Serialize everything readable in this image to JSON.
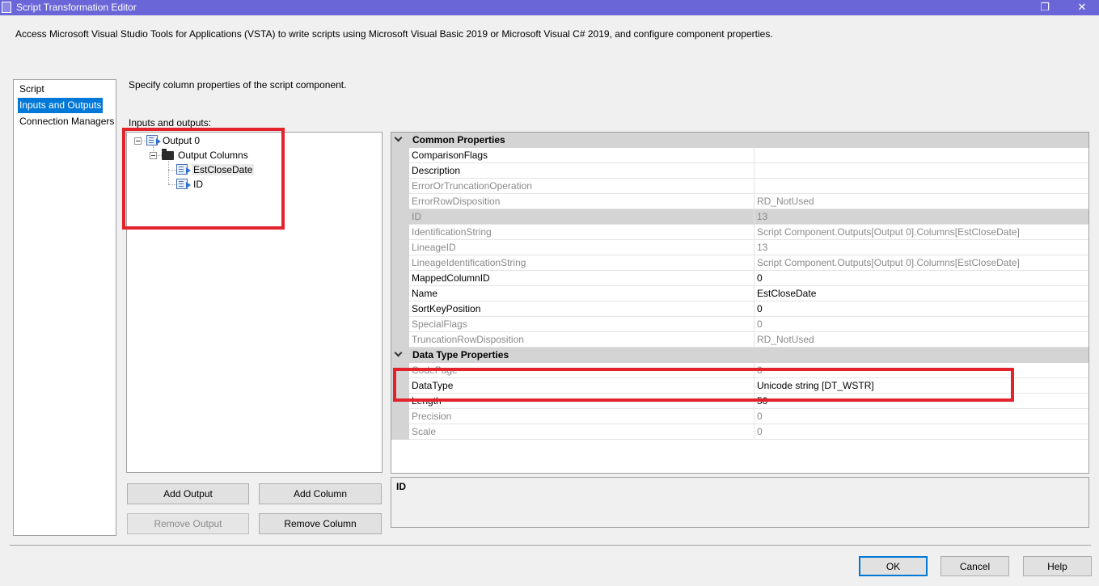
{
  "window": {
    "title": "Script Transformation Editor",
    "restore_glyph": "❐",
    "close_glyph": "✕"
  },
  "header": {
    "description": "Access Microsoft Visual Studio Tools for Applications (VSTA) to write scripts using Microsoft Visual Basic 2019 or Microsoft Visual C# 2019, and configure component properties."
  },
  "sidebar": {
    "items": [
      {
        "label": "Script",
        "selected": false
      },
      {
        "label": "Inputs and Outputs",
        "selected": true
      },
      {
        "label": "Connection Managers",
        "selected": false
      }
    ]
  },
  "main": {
    "description": "Specify column properties of the script component.",
    "tree_label": "Inputs and outputs:",
    "tree": {
      "output": "Output 0",
      "columns_folder": "Output Columns",
      "columns": [
        "EstCloseDate",
        "ID"
      ],
      "selected_column": "EstCloseDate"
    }
  },
  "buttons": {
    "add_output": "Add Output",
    "add_column": "Add Column",
    "remove_output": "Remove Output",
    "remove_column": "Remove Column",
    "ok": "OK",
    "cancel": "Cancel",
    "help": "Help"
  },
  "properties": {
    "categories": [
      {
        "label": "Common Properties",
        "rows": [
          {
            "name": "ComparisonFlags",
            "value": "",
            "readonly": false
          },
          {
            "name": "Description",
            "value": "",
            "readonly": false
          },
          {
            "name": "ErrorOrTruncationOperation",
            "value": "",
            "readonly": true
          },
          {
            "name": "ErrorRowDisposition",
            "value": "RD_NotUsed",
            "readonly": true
          },
          {
            "name": "ID",
            "value": "13",
            "readonly": true,
            "selected": true
          },
          {
            "name": "IdentificationString",
            "value": "Script Component.Outputs[Output 0].Columns[EstCloseDate]",
            "readonly": true
          },
          {
            "name": "LineageID",
            "value": "13",
            "readonly": true
          },
          {
            "name": "LineageIdentificationString",
            "value": "Script Component.Outputs[Output 0].Columns[EstCloseDate]",
            "readonly": true
          },
          {
            "name": "MappedColumnID",
            "value": "0",
            "readonly": false
          },
          {
            "name": "Name",
            "value": "EstCloseDate",
            "readonly": false
          },
          {
            "name": "SortKeyPosition",
            "value": "0",
            "readonly": false
          },
          {
            "name": "SpecialFlags",
            "value": "0",
            "readonly": true
          },
          {
            "name": "TruncationRowDisposition",
            "value": "RD_NotUsed",
            "readonly": true
          }
        ]
      },
      {
        "label": "Data Type Properties",
        "rows": [
          {
            "name": "CodePage",
            "value": "0",
            "readonly": true
          },
          {
            "name": "DataType",
            "value": "Unicode string [DT_WSTR]",
            "readonly": false
          },
          {
            "name": "Length",
            "value": "50",
            "readonly": false
          },
          {
            "name": "Precision",
            "value": "0",
            "readonly": true
          },
          {
            "name": "Scale",
            "value": "0",
            "readonly": true
          }
        ]
      }
    ]
  },
  "help_panel": {
    "title": "ID"
  },
  "colors": {
    "titlebar": "#6b66d8",
    "selection": "#0078d7",
    "highlight_box": "#e3232c"
  }
}
